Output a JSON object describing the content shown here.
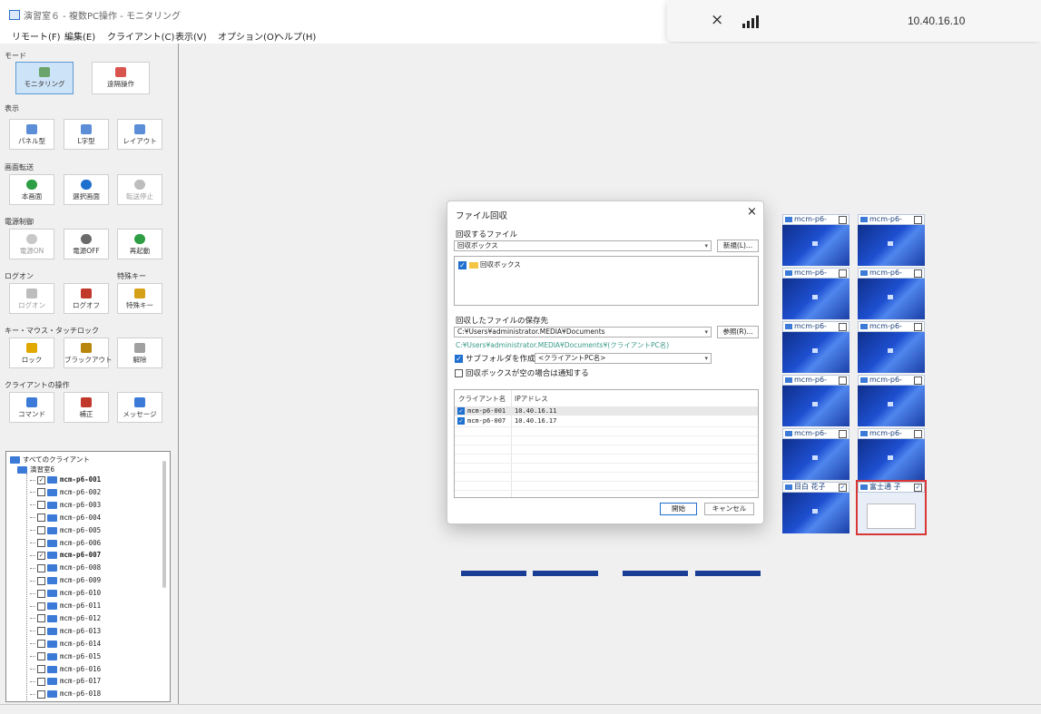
{
  "window": {
    "title": "演習室６ - 複数PC操作 - モニタリング"
  },
  "menu": [
    "リモート(F)",
    "編集(E)",
    "クライアント(C)",
    "表示(V)",
    "オプション(O)",
    "ヘルプ(H)"
  ],
  "system": {
    "ip": "10.40.16.10",
    "bluetooth_icon": "bluetooth-off-icon",
    "signal_icon": "signal-icon"
  },
  "left": {
    "mode_label": "モード",
    "mode_buttons": [
      "モニタリング",
      "遠隔操作"
    ],
    "view_label": "表示",
    "view_buttons": [
      "パネル型",
      "L字型",
      "レイアウト"
    ],
    "screen_label": "画面転送",
    "screen_buttons": [
      "本画面",
      "選択画面",
      "転送停止"
    ],
    "power_label": "電源制御",
    "power_buttons": [
      "電源ON",
      "電源OFF",
      "再起動"
    ],
    "logon_label": "ログオン",
    "special_label": "特殊キー",
    "logon_buttons": [
      "ログオン",
      "ログオフ",
      "特殊キー"
    ],
    "lock_label": "キー・マウス・タッチロック",
    "lock_buttons": [
      "ロック",
      "ブラックアウト",
      "解除"
    ],
    "client_label": "クライアントの操作",
    "client_buttons": [
      "コマンド",
      "補正",
      "メッセージ"
    ]
  },
  "tree": {
    "root": "すべてのクライアント",
    "group": "演習室6",
    "items": [
      {
        "name": "mcm-p6-001",
        "checked": true
      },
      {
        "name": "mcm-p6-002",
        "checked": false
      },
      {
        "name": "mcm-p6-003",
        "checked": false
      },
      {
        "name": "mcm-p6-004",
        "checked": false
      },
      {
        "name": "mcm-p6-005",
        "checked": false
      },
      {
        "name": "mcm-p6-006",
        "checked": false
      },
      {
        "name": "mcm-p6-007",
        "checked": true
      },
      {
        "name": "mcm-p6-008",
        "checked": false
      },
      {
        "name": "mcm-p6-009",
        "checked": false
      },
      {
        "name": "mcm-p6-010",
        "checked": false
      },
      {
        "name": "mcm-p6-011",
        "checked": false
      },
      {
        "name": "mcm-p6-012",
        "checked": false
      },
      {
        "name": "mcm-p6-013",
        "checked": false
      },
      {
        "name": "mcm-p6-014",
        "checked": false
      },
      {
        "name": "mcm-p6-015",
        "checked": false
      },
      {
        "name": "mcm-p6-016",
        "checked": false
      },
      {
        "name": "mcm-p6-017",
        "checked": false
      },
      {
        "name": "mcm-p6-018",
        "checked": false
      }
    ]
  },
  "tiles": {
    "generic": "mcm-p6-",
    "special": [
      {
        "label": "目白 花子",
        "checked": true,
        "selected": false
      },
      {
        "label": "富士通 子",
        "checked": true,
        "selected": true
      }
    ]
  },
  "dialog": {
    "title": "ファイル回収",
    "close": "×",
    "files_label": "回収するファイル",
    "files_combo": "回収ボックス",
    "new_button": "新規(L)...",
    "box_item": "回収ボックス",
    "dest_label": "回収したファイルの保存先",
    "dest_path": "C:¥Users¥administrator.MEDIA¥Documents",
    "browse_button": "参照(R)...",
    "preview_path": "C:¥Users¥administrator.MEDIA¥Documents¥(クライアントPC名)",
    "subfolder_label": "サブフォルダを作成",
    "subfolder_combo": "<クライアントPC名>",
    "notify_label": "回収ボックスが空の場合は通知する",
    "col_client": "クライアント名",
    "col_ip": "IPアドレス",
    "rows": [
      {
        "client": "mcm-p6-001",
        "ip": "10.40.16.11"
      },
      {
        "client": "mcm-p6-007",
        "ip": "10.40.16.17"
      }
    ],
    "start_button": "開始",
    "cancel_button": "キャンセル"
  }
}
